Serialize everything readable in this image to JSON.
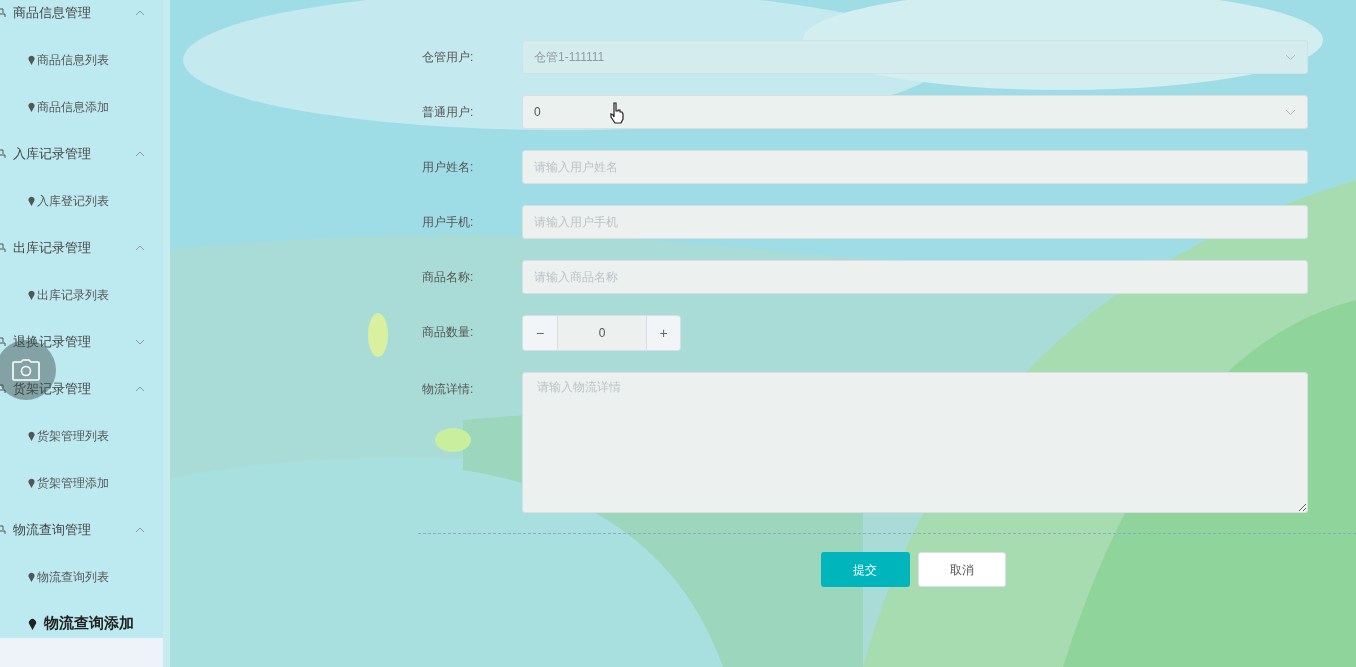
{
  "sidebar": {
    "groups": [
      {
        "label": "商品信息管理",
        "expanded": true,
        "children": [
          {
            "label": "商品信息列表",
            "selected": false
          },
          {
            "label": "商品信息添加",
            "selected": false
          }
        ]
      },
      {
        "label": "入库记录管理",
        "expanded": true,
        "children": [
          {
            "label": "入库登记列表",
            "selected": false
          }
        ]
      },
      {
        "label": "出库记录管理",
        "expanded": true,
        "children": [
          {
            "label": "出库记录列表",
            "selected": false
          }
        ]
      },
      {
        "label": "退换记录管理",
        "expanded": false
      },
      {
        "label": "货架记录管理",
        "expanded": true,
        "children": [
          {
            "label": "货架管理列表",
            "selected": false
          },
          {
            "label": "货架管理添加",
            "selected": false
          }
        ]
      },
      {
        "label": "物流查询管理",
        "expanded": true,
        "children": [
          {
            "label": "物流查询列表",
            "selected": false
          },
          {
            "label": "物流查询添加",
            "selected": true
          }
        ]
      }
    ]
  },
  "form": {
    "fields": [
      {
        "kind": "select",
        "label": "仓管用户:",
        "value": "仓管1-111111",
        "disabled": true
      },
      {
        "kind": "select",
        "label": "普通用户:",
        "value": "0",
        "disabled": false
      },
      {
        "kind": "input",
        "label": "用户姓名:",
        "placeholder": "请输入用户姓名"
      },
      {
        "kind": "input",
        "label": "用户手机:",
        "placeholder": "请输入用户手机"
      },
      {
        "kind": "input",
        "label": "商品名称:",
        "placeholder": "请输入商品名称"
      },
      {
        "kind": "number",
        "label": "商品数量:",
        "value": "0",
        "minus": "−",
        "plus": "+"
      },
      {
        "kind": "textarea",
        "label": "物流详情:",
        "placeholder": "请输入物流详情"
      }
    ],
    "buttons": [
      {
        "kind": "primary",
        "label": "提交"
      },
      {
        "kind": "default",
        "label": "取消"
      }
    ]
  }
}
